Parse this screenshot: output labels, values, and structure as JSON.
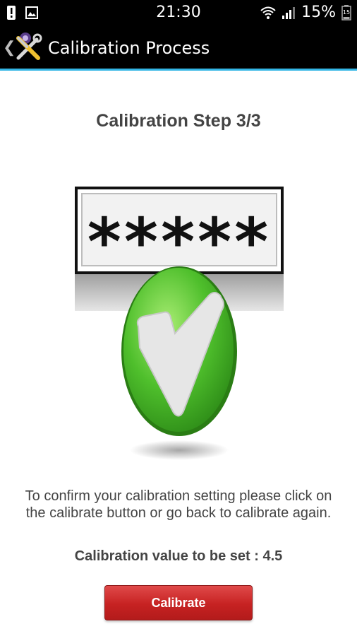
{
  "status_bar": {
    "time": "21:30",
    "battery_percent": "15%",
    "battery_level": "15",
    "icons": [
      "alert-icon",
      "image-icon",
      "wifi-icon",
      "signal-icon",
      "battery-icon"
    ]
  },
  "action_bar": {
    "title": "Calibration Process",
    "back_icon": "chevron-left-icon",
    "app_icon": "tools-icon",
    "accent_color": "#33b5e5"
  },
  "main": {
    "step_title": "Calibration Step 3/3",
    "password_mask": "*****",
    "instructions": "To confirm your calibration setting please click on the calibrate button or go back to calibrate again.",
    "calibration_value_text": "Calibration value to be set : 4.5",
    "calibrate_button_label": "Calibrate",
    "button_color": "#c62222",
    "check_color": "#3aa12a"
  }
}
